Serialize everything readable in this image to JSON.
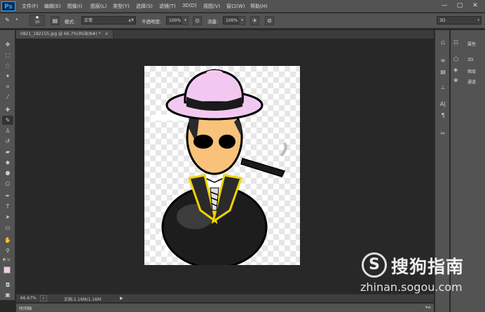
{
  "app": {
    "logo": "Ps"
  },
  "menu": [
    "文件(F)",
    "编辑(E)",
    "图像(I)",
    "图层(L)",
    "类型(Y)",
    "选择(S)",
    "滤镜(T)",
    "3D(D)",
    "视图(V)",
    "窗口(W)",
    "帮助(H)"
  ],
  "window_controls": {
    "minimize": "—",
    "restore": "▢",
    "close": "✕"
  },
  "options": {
    "brush_size": "10",
    "mode_label": "模式:",
    "mode_value": "正常",
    "opacity_label": "不透明度:",
    "opacity_value": "100%",
    "flow_label": "流量:",
    "flow_value": "100%",
    "workspace_value": "3D"
  },
  "document": {
    "tab_title": "0821_182155.jpg @ 66.7%(RGB/8#) *",
    "close_glyph": "×"
  },
  "status": {
    "zoom": "66.67%",
    "doc_info": "文档:1.16M/1.16M"
  },
  "timeline": {
    "tab_label": "时间轴"
  },
  "panels": [
    {
      "icon": "properties-icon",
      "label": "属性"
    },
    {
      "icon": "3d-icon",
      "label": "3D"
    },
    {
      "icon": "layers-icon",
      "label": "图层"
    },
    {
      "icon": "channels-icon",
      "label": "通道"
    }
  ],
  "watermark": {
    "logo_glyph": "S",
    "title": "搜狗指南",
    "url": "zhinan.sogou.com"
  },
  "colors": {
    "ui_bg": "#535353",
    "canvas_bg": "#282828",
    "accent": "#31a8ff"
  }
}
